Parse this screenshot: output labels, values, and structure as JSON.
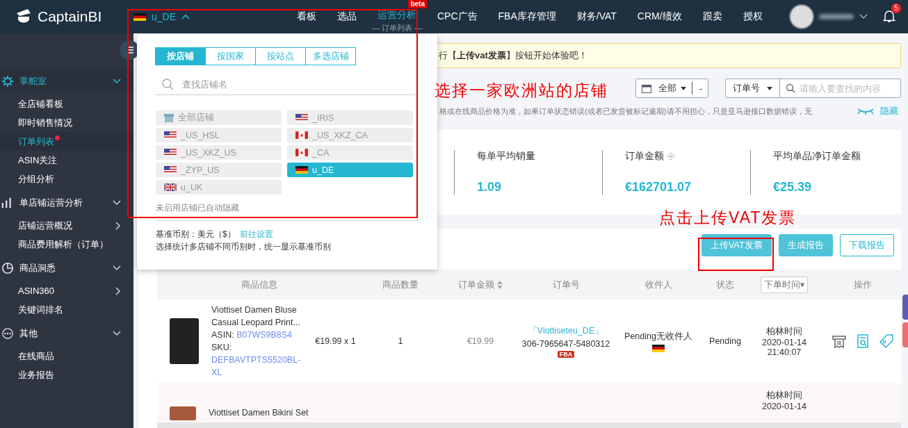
{
  "logo": {
    "text": "CaptainBI"
  },
  "store_selector": {
    "name": "u_DE",
    "expanded": true
  },
  "nav": [
    {
      "label": "看板",
      "selected": false
    },
    {
      "label": "选品",
      "selected": false
    },
    {
      "label": "运营分析",
      "selected": true,
      "sub": "— 订单列表 —",
      "badge": "beta"
    },
    {
      "label": "CPC广告",
      "selected": false
    },
    {
      "label": "FBA库存管理",
      "selected": false
    },
    {
      "label": "财务/VAT",
      "selected": false
    },
    {
      "label": "CRM/绩效",
      "selected": false
    },
    {
      "label": "跟卖",
      "selected": false
    },
    {
      "label": "授权",
      "selected": false
    }
  ],
  "notifications": {
    "count": "5"
  },
  "sidebar": {
    "groups": [
      {
        "label": "掌舵室",
        "expanded": true,
        "selected": true,
        "children": [
          {
            "label": "全店铺看板",
            "selected": false
          },
          {
            "label": "即时销售情况",
            "selected": false
          },
          {
            "label": "订单列表",
            "selected": true,
            "dot": true
          },
          {
            "label": "ASIN关注",
            "selected": false
          },
          {
            "label": "分组分析",
            "selected": false
          }
        ]
      },
      {
        "label": "单店铺运营分析",
        "expanded": true,
        "selected": false,
        "children": [
          {
            "label": "店铺运营概况",
            "selected": false,
            "more": true
          },
          {
            "label": "商品费用解析（订单）",
            "selected": false
          }
        ]
      },
      {
        "label": "商品洞悉",
        "expanded": true,
        "selected": false,
        "children": [
          {
            "label": "ASIN360",
            "selected": false,
            "more": true
          },
          {
            "label": "关键词排名",
            "selected": false
          }
        ]
      },
      {
        "label": "其他",
        "expanded": true,
        "selected": false,
        "children": [
          {
            "label": "在线商品",
            "selected": false
          },
          {
            "label": "业务报告",
            "selected": false
          }
        ]
      }
    ]
  },
  "store_dropdown": {
    "tabs": [
      {
        "label": "按店铺",
        "selected": true
      },
      {
        "label": "按国家",
        "selected": false
      },
      {
        "label": "按站点",
        "selected": false
      },
      {
        "label": "多选店铺",
        "selected": false
      }
    ],
    "search": {
      "placeholder": "查找店铺名"
    },
    "stores": [
      {
        "name": "全部店铺",
        "kind": "all",
        "selected": false
      },
      {
        "name": "_IRIS",
        "kind": "us",
        "selected": false
      },
      {
        "name": "_US_HSL",
        "kind": "us",
        "selected": false
      },
      {
        "name": "_US_XKZ_CA",
        "kind": "ca",
        "selected": false
      },
      {
        "name": "_US_XKZ_US",
        "kind": "us",
        "selected": false
      },
      {
        "name": "_CA",
        "kind": "ca",
        "selected": false
      },
      {
        "name": "_ZYP_US",
        "kind": "us",
        "selected": false
      },
      {
        "name": "u_DE",
        "kind": "de",
        "selected": true
      },
      {
        "name": "u_UK",
        "kind": "uk",
        "selected": false
      }
    ],
    "hidden_note": "未启用店铺已自动隐藏",
    "currency_label": "基准币别：美元（$）",
    "currency_link": "前往设置",
    "currency_note": "选择统计多店铺不同币别时，统一显示基准币别"
  },
  "notice": "行【**上传vat发票**】按钮开始体验吧！",
  "date_filter": {
    "value": "全部",
    "end": "-"
  },
  "search_filter": {
    "field": "订单号",
    "placeholder": "请输入要查找的内容"
  },
  "info_text": "格或在线商品价格为准，如果订单状态错误(或者已发货被标记逾期)请不用担心，只是亚马逊接口数据错误，无",
  "hide_link": "隐藏",
  "stats": [
    {
      "label": "每单平均销量",
      "value": "1.09"
    },
    {
      "label": "订单金额",
      "value": "€162701.07",
      "help": true
    },
    {
      "label": "平均单品净订单金额",
      "value": "€25.39"
    }
  ],
  "annotations": [
    "选择一家欧洲站的店铺",
    "点击上传VAT发票"
  ],
  "buttons": [
    {
      "label": "上传VAT发票",
      "kind": "primary"
    },
    {
      "label": "生成报告",
      "kind": "primary"
    },
    {
      "label": "下载报告",
      "kind": "outline"
    }
  ],
  "table": {
    "columns": [
      "商品信息",
      "商品数量",
      "订单金额",
      "订单号",
      "收件人",
      "状态",
      "下单时间▾",
      "操作"
    ],
    "rows": [
      {
        "title": "Viottiset Damen Bluse Casual Leopard Print...",
        "asin_label": "ASIN:",
        "asin": "B07WS9B8S4",
        "sku_label": "SKU:",
        "sku": "DEFBAVTPTS5520BL-XL",
        "price": "€19.99 x 1",
        "quantity": "1",
        "amount": "€19.99",
        "store": "「Viottiseteu_DE」",
        "order_no": "306-7965647-5480312",
        "fulfillment": "FBA",
        "recipient": "Pending无收件人",
        "status": "Pending",
        "tz": "柏林时间",
        "date": "2020-01-14",
        "time": "21:40:07"
      },
      {
        "title": "Viottiset Damen Bikini Set",
        "tz": "柏林时间",
        "date": "2020-01-14"
      }
    ]
  }
}
